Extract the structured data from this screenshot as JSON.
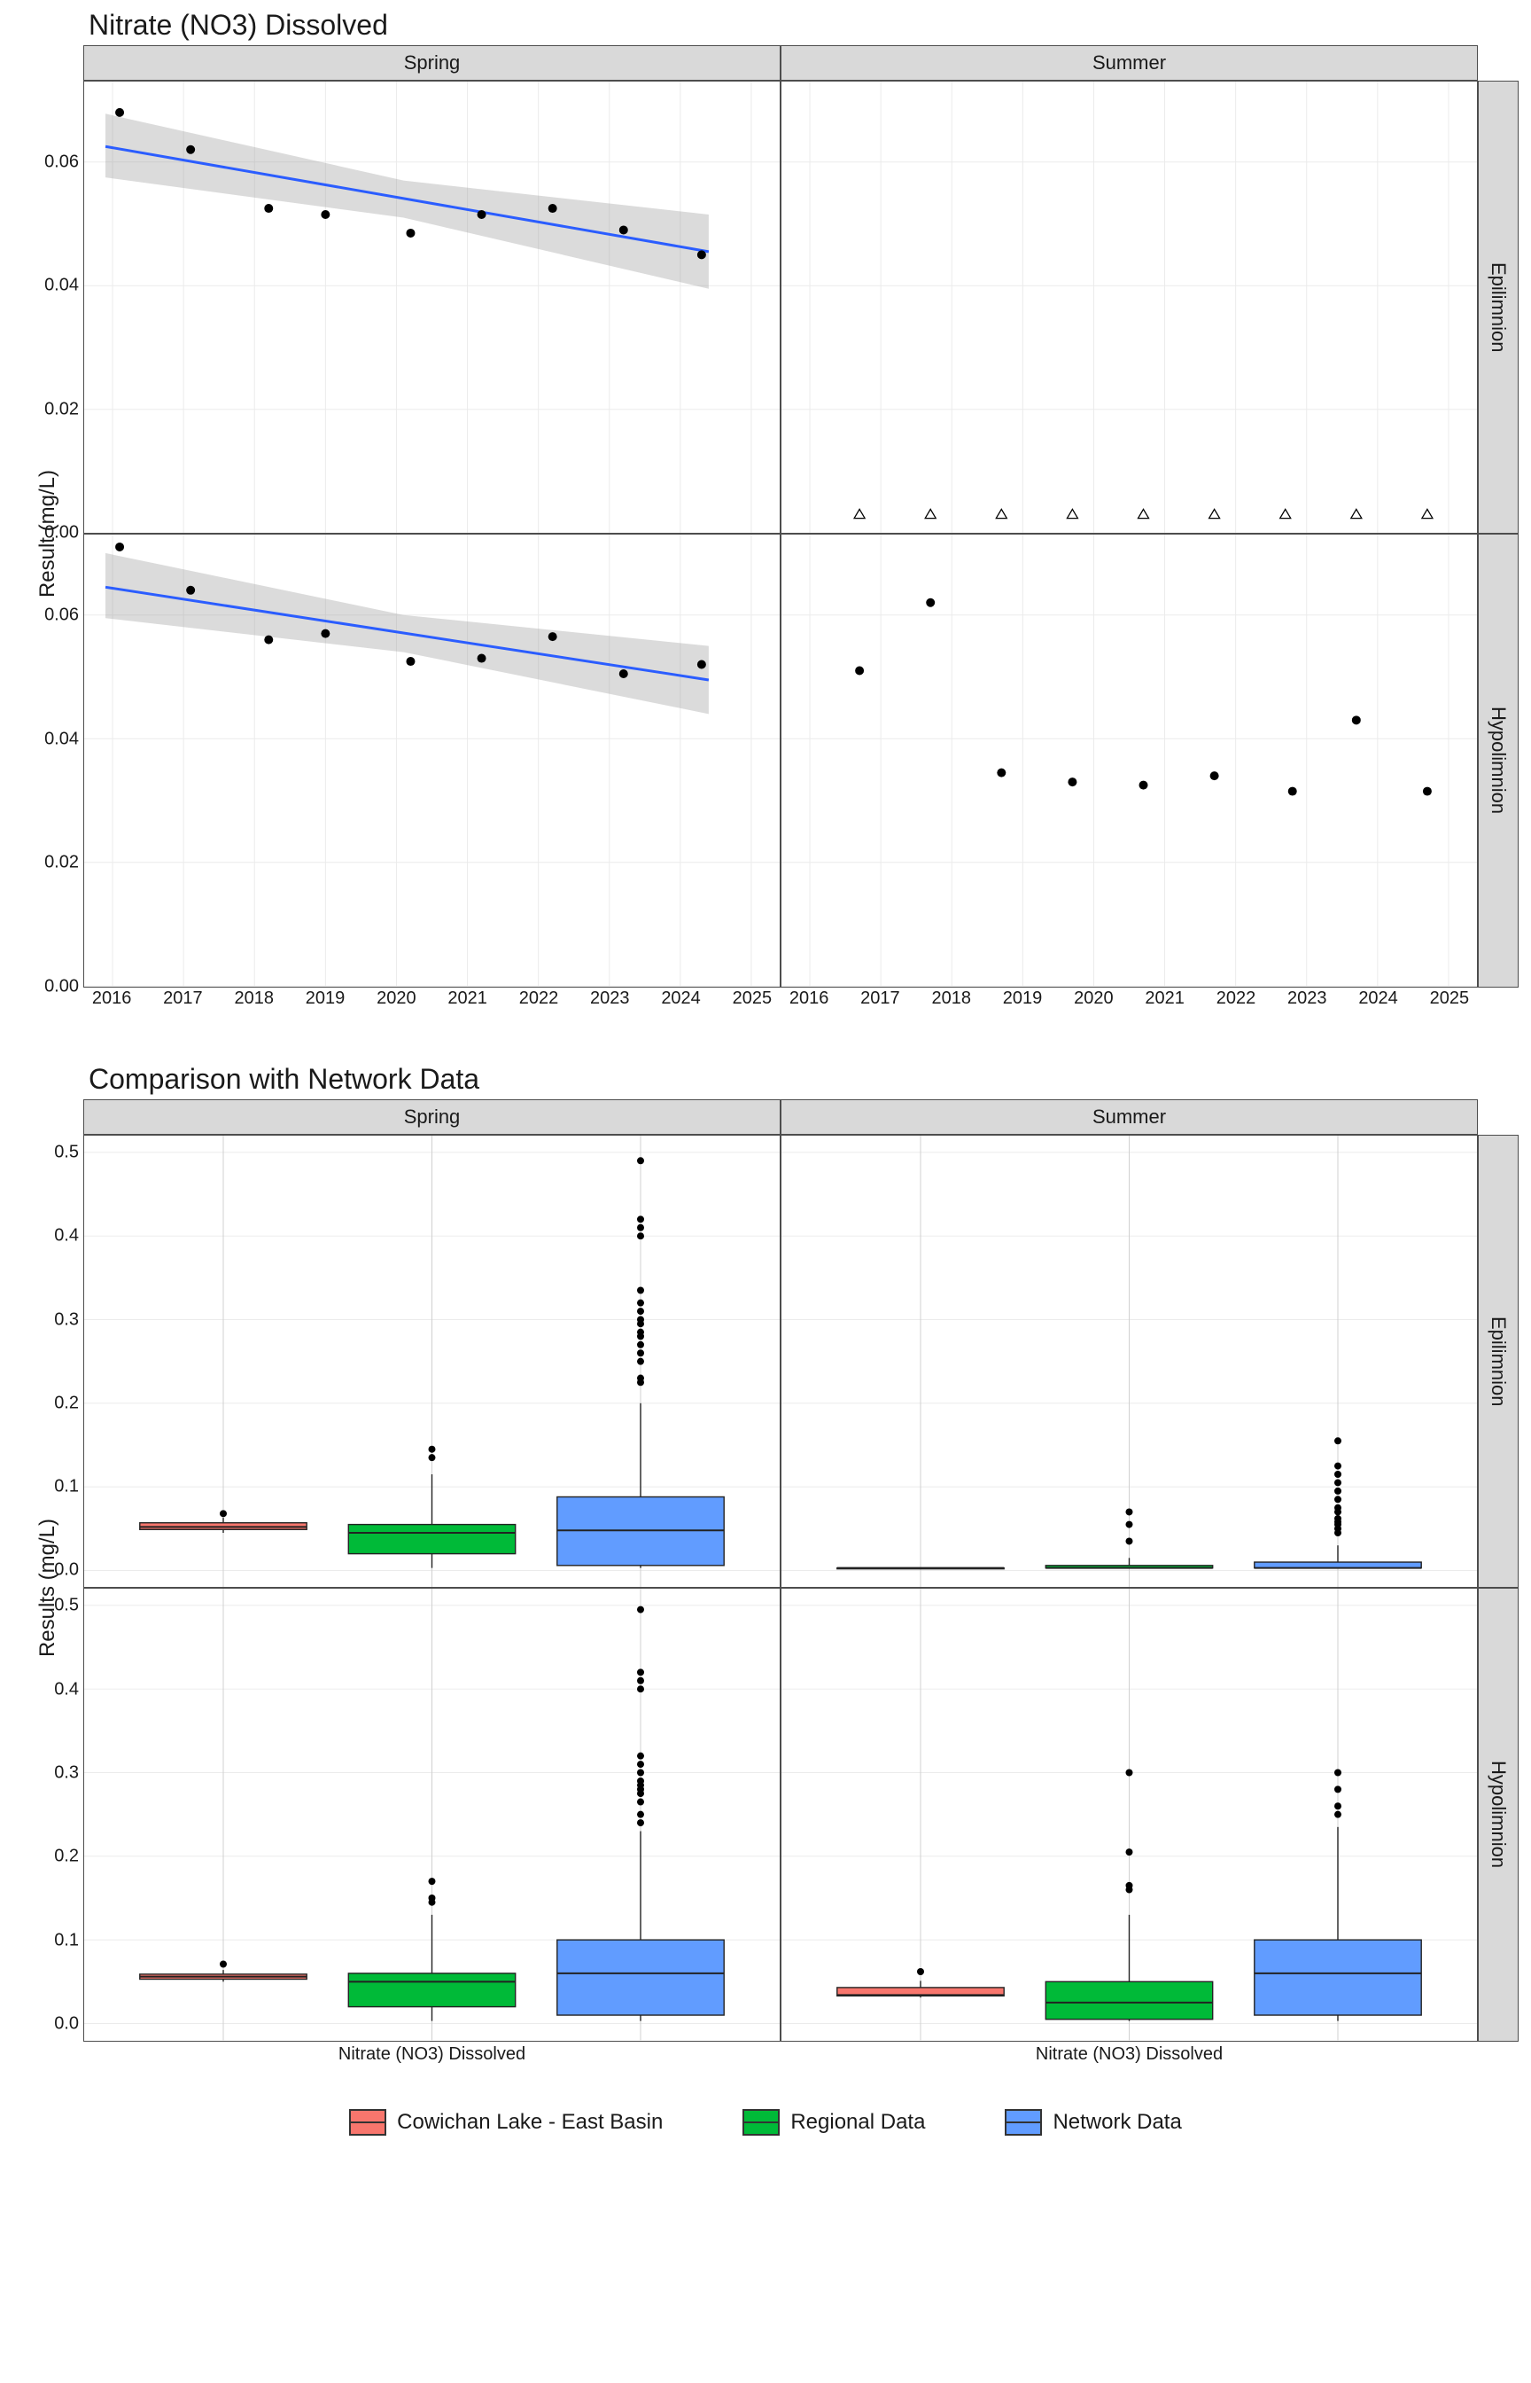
{
  "chart_data": [
    {
      "id": "scatter",
      "type": "scatter",
      "title": "Nitrate (NO3) Dissolved",
      "xlabel": "",
      "ylabel": "Result (mg/L)",
      "x_ticks": [
        2016,
        2017,
        2018,
        2019,
        2020,
        2021,
        2022,
        2023,
        2024,
        2025
      ],
      "y_ticks": [
        0.0,
        0.02,
        0.04,
        0.06
      ],
      "xlim": [
        2015.6,
        2025.4
      ],
      "ylim": [
        0.0,
        0.073
      ],
      "facet_cols": [
        "Spring",
        "Summer"
      ],
      "facet_rows": [
        "Epilimnion",
        "Hypolimnion"
      ],
      "panels": {
        "Spring|Epilimnion": {
          "points": [
            {
              "x": 2016.1,
              "y": 0.068
            },
            {
              "x": 2017.1,
              "y": 0.062
            },
            {
              "x": 2018.2,
              "y": 0.0525
            },
            {
              "x": 2019.0,
              "y": 0.0515
            },
            {
              "x": 2020.2,
              "y": 0.0485
            },
            {
              "x": 2021.2,
              "y": 0.0515
            },
            {
              "x": 2022.2,
              "y": 0.0525
            },
            {
              "x": 2023.2,
              "y": 0.049
            },
            {
              "x": 2024.3,
              "y": 0.045
            }
          ],
          "open_points": [],
          "trend": {
            "x1": 2015.9,
            "y1": 0.0625,
            "x2": 2024.4,
            "y2": 0.0455
          },
          "ci": [
            {
              "x": 2015.9,
              "lo": 0.0575,
              "hi": 0.0678
            },
            {
              "x": 2020.1,
              "lo": 0.051,
              "hi": 0.057
            },
            {
              "x": 2024.4,
              "lo": 0.0395,
              "hi": 0.0515
            }
          ]
        },
        "Summer|Epilimnion": {
          "points": [],
          "open_points": [
            {
              "x": 2016.7,
              "y": 0.003
            },
            {
              "x": 2017.7,
              "y": 0.003
            },
            {
              "x": 2018.7,
              "y": 0.003
            },
            {
              "x": 2019.7,
              "y": 0.003
            },
            {
              "x": 2020.7,
              "y": 0.003
            },
            {
              "x": 2021.7,
              "y": 0.003
            },
            {
              "x": 2022.7,
              "y": 0.003
            },
            {
              "x": 2023.7,
              "y": 0.003
            },
            {
              "x": 2024.7,
              "y": 0.003
            }
          ],
          "trend": null,
          "ci": null
        },
        "Spring|Hypolimnion": {
          "points": [
            {
              "x": 2016.1,
              "y": 0.071
            },
            {
              "x": 2017.1,
              "y": 0.064
            },
            {
              "x": 2018.2,
              "y": 0.056
            },
            {
              "x": 2019.0,
              "y": 0.057
            },
            {
              "x": 2020.2,
              "y": 0.0525
            },
            {
              "x": 2021.2,
              "y": 0.053
            },
            {
              "x": 2022.2,
              "y": 0.0565
            },
            {
              "x": 2023.2,
              "y": 0.0505
            },
            {
              "x": 2024.3,
              "y": 0.052
            }
          ],
          "open_points": [],
          "trend": {
            "x1": 2015.9,
            "y1": 0.0645,
            "x2": 2024.4,
            "y2": 0.0495
          },
          "ci": [
            {
              "x": 2015.9,
              "lo": 0.0595,
              "hi": 0.07
            },
            {
              "x": 2020.1,
              "lo": 0.054,
              "hi": 0.06
            },
            {
              "x": 2024.4,
              "lo": 0.044,
              "hi": 0.055
            }
          ]
        },
        "Summer|Hypolimnion": {
          "points": [
            {
              "x": 2016.7,
              "y": 0.051
            },
            {
              "x": 2017.7,
              "y": 0.062
            },
            {
              "x": 2018.7,
              "y": 0.0345
            },
            {
              "x": 2019.7,
              "y": 0.033
            },
            {
              "x": 2020.7,
              "y": 0.0325
            },
            {
              "x": 2021.7,
              "y": 0.034
            },
            {
              "x": 2022.8,
              "y": 0.0315
            },
            {
              "x": 2023.7,
              "y": 0.043
            },
            {
              "x": 2024.7,
              "y": 0.0315
            }
          ],
          "open_points": [],
          "trend": null,
          "ci": null
        }
      }
    },
    {
      "id": "box",
      "type": "box",
      "title": "Comparison with Network Data",
      "xlabel": "Nitrate (NO3) Dissolved",
      "ylabel": "Results (mg/L)",
      "x_category": "Nitrate (NO3) Dissolved",
      "y_ticks": [
        0.0,
        0.1,
        0.2,
        0.3,
        0.4,
        0.5
      ],
      "ylim": [
        -0.02,
        0.52
      ],
      "facet_cols": [
        "Spring",
        "Summer"
      ],
      "facet_rows": [
        "Epilimnion",
        "Hypolimnion"
      ],
      "groups": [
        "Cowichan Lake - East Basin",
        "Regional Data",
        "Network Data"
      ],
      "colors": {
        "Cowichan Lake - East Basin": "#F8766D",
        "Regional Data": "#00BA38",
        "Network Data": "#619CFF"
      },
      "panels": {
        "Spring|Epilimnion": [
          {
            "group": "Cowichan Lake - East Basin",
            "min": 0.045,
            "q1": 0.049,
            "med": 0.052,
            "q3": 0.057,
            "max": 0.063,
            "outliers": [
              0.068
            ]
          },
          {
            "group": "Regional Data",
            "min": 0.003,
            "q1": 0.02,
            "med": 0.045,
            "q3": 0.055,
            "max": 0.115,
            "outliers": [
              0.135,
              0.145
            ]
          },
          {
            "group": "Network Data",
            "min": 0.003,
            "q1": 0.006,
            "med": 0.048,
            "q3": 0.088,
            "max": 0.2,
            "outliers": [
              0.225,
              0.23,
              0.25,
              0.26,
              0.27,
              0.28,
              0.285,
              0.295,
              0.3,
              0.31,
              0.32,
              0.335,
              0.4,
              0.41,
              0.42,
              0.49
            ]
          }
        ],
        "Summer|Epilimnion": [
          {
            "group": "Cowichan Lake - East Basin",
            "min": 0.003,
            "q1": 0.003,
            "med": 0.003,
            "q3": 0.003,
            "max": 0.003,
            "outliers": []
          },
          {
            "group": "Regional Data",
            "min": 0.003,
            "q1": 0.003,
            "med": 0.003,
            "q3": 0.006,
            "max": 0.015,
            "outliers": [
              0.035,
              0.055,
              0.07
            ]
          },
          {
            "group": "Network Data",
            "min": 0.003,
            "q1": 0.003,
            "med": 0.003,
            "q3": 0.01,
            "max": 0.03,
            "outliers": [
              0.045,
              0.05,
              0.055,
              0.058,
              0.062,
              0.07,
              0.075,
              0.085,
              0.095,
              0.105,
              0.115,
              0.125,
              0.155
            ]
          }
        ],
        "Spring|Hypolimnion": [
          {
            "group": "Cowichan Lake - East Basin",
            "min": 0.05,
            "q1": 0.053,
            "med": 0.056,
            "q3": 0.059,
            "max": 0.064,
            "outliers": [
              0.071
            ]
          },
          {
            "group": "Regional Data",
            "min": 0.003,
            "q1": 0.02,
            "med": 0.05,
            "q3": 0.06,
            "max": 0.13,
            "outliers": [
              0.145,
              0.15,
              0.17
            ]
          },
          {
            "group": "Network Data",
            "min": 0.003,
            "q1": 0.01,
            "med": 0.06,
            "q3": 0.1,
            "max": 0.23,
            "outliers": [
              0.24,
              0.25,
              0.265,
              0.275,
              0.28,
              0.285,
              0.29,
              0.3,
              0.31,
              0.32,
              0.4,
              0.41,
              0.42,
              0.495
            ]
          }
        ],
        "Summer|Hypolimnion": [
          {
            "group": "Cowichan Lake - East Basin",
            "min": 0.031,
            "q1": 0.033,
            "med": 0.034,
            "q3": 0.043,
            "max": 0.051,
            "outliers": [
              0.062
            ]
          },
          {
            "group": "Regional Data",
            "min": 0.003,
            "q1": 0.005,
            "med": 0.025,
            "q3": 0.05,
            "max": 0.13,
            "outliers": [
              0.16,
              0.165,
              0.205,
              0.3
            ]
          },
          {
            "group": "Network Data",
            "min": 0.003,
            "q1": 0.01,
            "med": 0.06,
            "q3": 0.1,
            "max": 0.235,
            "outliers": [
              0.25,
              0.26,
              0.28,
              0.3
            ]
          }
        ]
      }
    }
  ],
  "legend": {
    "items": [
      {
        "label": "Cowichan Lake - East Basin",
        "color": "#F8766D"
      },
      {
        "label": "Regional Data",
        "color": "#00BA38"
      },
      {
        "label": "Network Data",
        "color": "#619CFF"
      }
    ]
  }
}
